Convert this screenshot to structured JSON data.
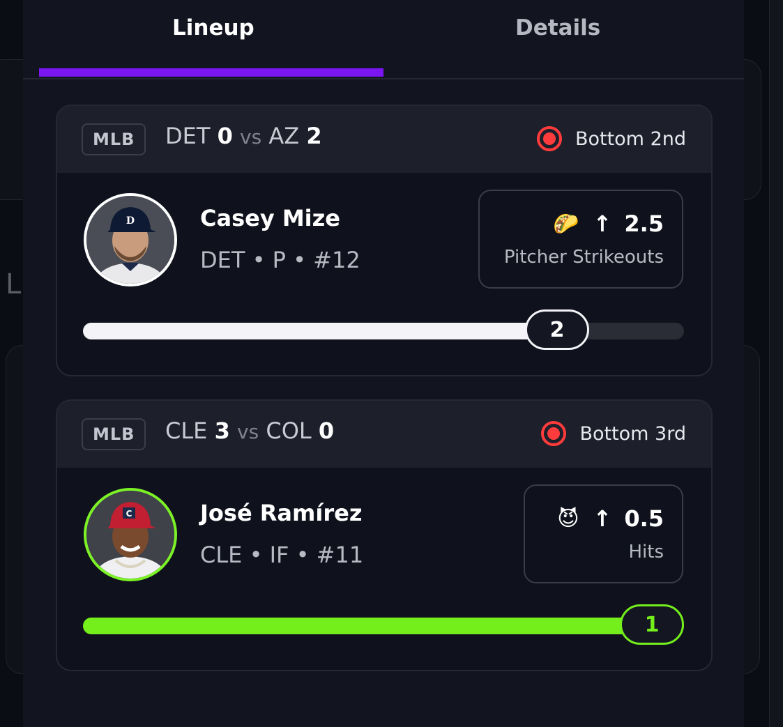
{
  "background": {
    "peek_letter": "L"
  },
  "tabs": [
    {
      "label": "Lineup",
      "active": true
    },
    {
      "label": "Details",
      "active": false
    }
  ],
  "colors": {
    "accent": "#7b16f2",
    "live": "#ff3b3b",
    "hit": "#74ef1c"
  },
  "cards": [
    {
      "league": "MLB",
      "home_team": "DET",
      "home_score": "0",
      "vs": "vs",
      "away_team": "AZ",
      "away_score": "2",
      "status": "Bottom 2nd",
      "player": {
        "name": "Casey Mize",
        "meta": "DET • P • #12"
      },
      "prop": {
        "emoji": "🌮",
        "direction": "↑",
        "line": "2.5",
        "stat": "Pitcher Strikeouts"
      },
      "progress": {
        "current": "2",
        "fraction": 0.8,
        "hit": false
      }
    },
    {
      "league": "MLB",
      "home_team": "CLE",
      "home_score": "3",
      "vs": "vs",
      "away_team": "COL",
      "away_score": "0",
      "status": "Bottom 3rd",
      "player": {
        "name": "José Ramírez",
        "meta": "CLE • IF • #11"
      },
      "prop": {
        "emoji": "😈",
        "direction": "↑",
        "line": "0.5",
        "stat": "Hits"
      },
      "progress": {
        "current": "1",
        "fraction": 1.0,
        "hit": true
      }
    }
  ]
}
